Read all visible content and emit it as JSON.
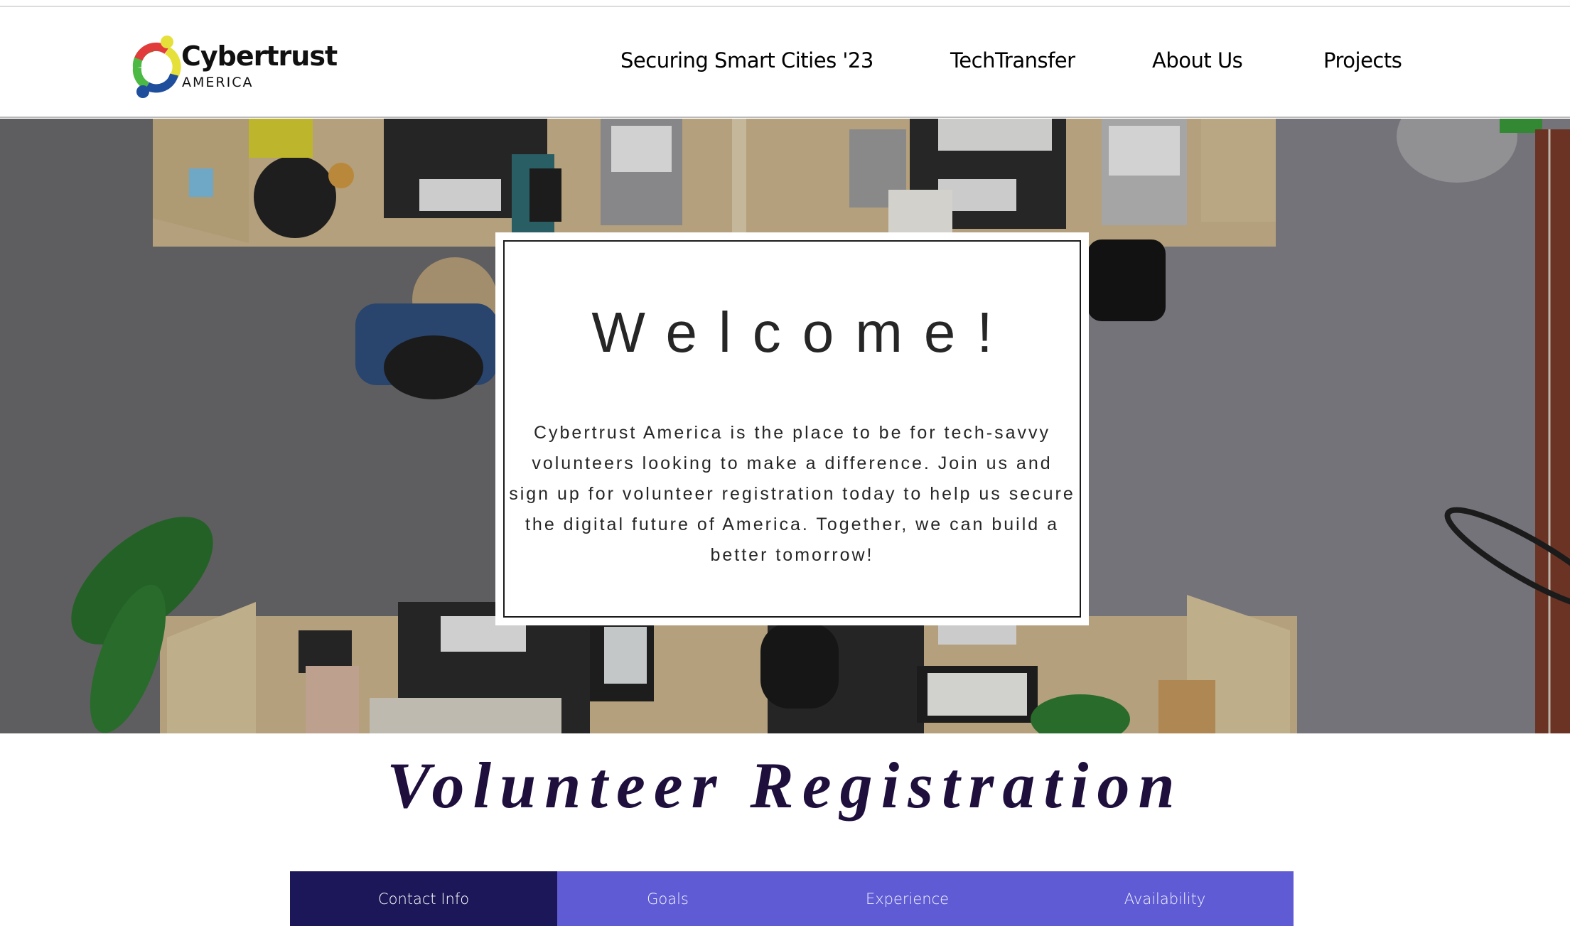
{
  "brand": {
    "name": "Cybertrust",
    "subtitle": "AMERICA",
    "colors": {
      "ring_red": "#e23b3b",
      "ring_yellow": "#e6e03a",
      "ring_blue": "#1f4e9c",
      "ring_green": "#4cb944"
    }
  },
  "nav": {
    "items": [
      {
        "label": "Securing Smart Cities '23"
      },
      {
        "label": "TechTransfer"
      },
      {
        "label": "About Us"
      },
      {
        "label": "Projects"
      }
    ]
  },
  "hero": {
    "image_description": "Overhead view of an office with wooden desks, laptops, monitors and people working",
    "welcome": {
      "title": "Welcome!",
      "text": "Cybertrust America is the place to be for tech-savvy volunteers looking to make a difference. Join us and sign up for volunteer registration today to help us secure the digital future of America. Together, we can build a better tomorrow!"
    }
  },
  "registration": {
    "title": "Volunteer Registration",
    "tabs": [
      {
        "label": "Contact Info",
        "active": true
      },
      {
        "label": "Goals",
        "active": false
      },
      {
        "label": "Experience",
        "active": false
      },
      {
        "label": "Availability",
        "active": false
      }
    ],
    "colors": {
      "tab_active": "#1c1759",
      "tab_inactive": "#5f5bd4",
      "title": "#1e0f3d"
    }
  }
}
